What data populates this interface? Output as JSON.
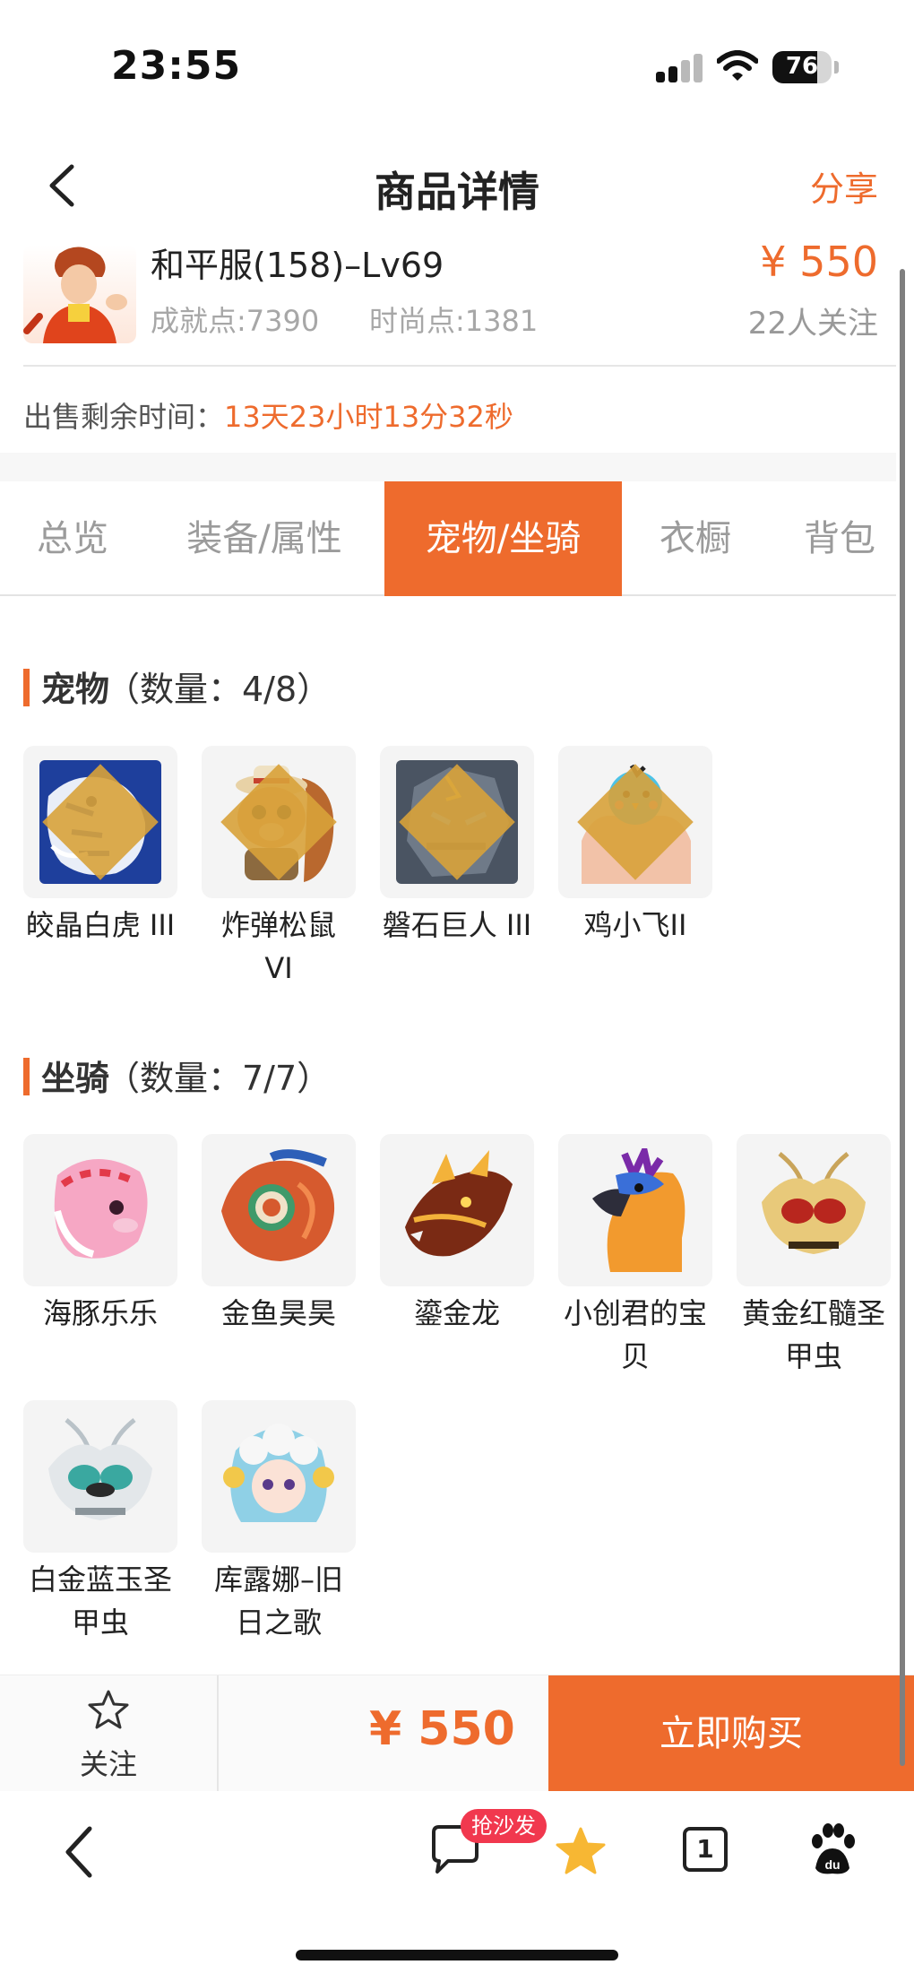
{
  "status_bar": {
    "time": "23:55",
    "battery": "76",
    "battery_level": 0.76
  },
  "header": {
    "title": "商品详情",
    "share_label": "分享"
  },
  "product": {
    "name": "和平服(158)–Lv69",
    "achievement": "成就点:7390",
    "fashion": "时尚点:1381",
    "price": "¥ 550",
    "followers": "22人关注",
    "remaining_label": "出售剩余时间：",
    "remaining_value": "13天23小时13分32秒"
  },
  "tabs": [
    {
      "label": "总览",
      "active": false
    },
    {
      "label": "装备/属性",
      "active": false
    },
    {
      "label": "宠物/坐骑",
      "active": true
    },
    {
      "label": "衣橱",
      "active": false
    },
    {
      "label": "背包",
      "active": false
    }
  ],
  "pets": {
    "title": "宠物",
    "count": "（数量：4/8）",
    "items": [
      {
        "name": "皎晶白虎 III",
        "rank": "III",
        "icon": "tiger-icon"
      },
      {
        "name": "炸弹松鼠 VI",
        "rank": "VI",
        "icon": "squirrel-icon"
      },
      {
        "name": "磐石巨人 III",
        "rank": "III",
        "icon": "rock-giant-icon"
      },
      {
        "name": "鸡小飞II",
        "rank": "II",
        "icon": "chick-icon"
      }
    ]
  },
  "mounts": {
    "title": "坐骑",
    "count": "（数量：7/7）",
    "items": [
      {
        "name": "海豚乐乐",
        "icon": "dolphin-icon"
      },
      {
        "name": "金鱼昊昊",
        "icon": "goldfish-icon"
      },
      {
        "name": "鎏金龙",
        "icon": "dragon-icon"
      },
      {
        "name": "小创君的宝贝",
        "icon": "phoenix-icon"
      },
      {
        "name": "黄金红髓圣甲虫",
        "icon": "gold-beetle-icon"
      },
      {
        "name": "白金蓝玉圣甲虫",
        "icon": "platinum-beetle-icon"
      },
      {
        "name": "库露娜–旧日之歌",
        "icon": "kuluna-icon"
      }
    ]
  },
  "footer": {
    "follow_label": "关注",
    "price": "¥ 550",
    "buy_label": "立即购买"
  },
  "browser": {
    "badge": "抢沙发",
    "tab_count": "1"
  },
  "colors": {
    "accent": "#ee6b2d",
    "badge": "#f1384e",
    "star": "#f7b733"
  }
}
